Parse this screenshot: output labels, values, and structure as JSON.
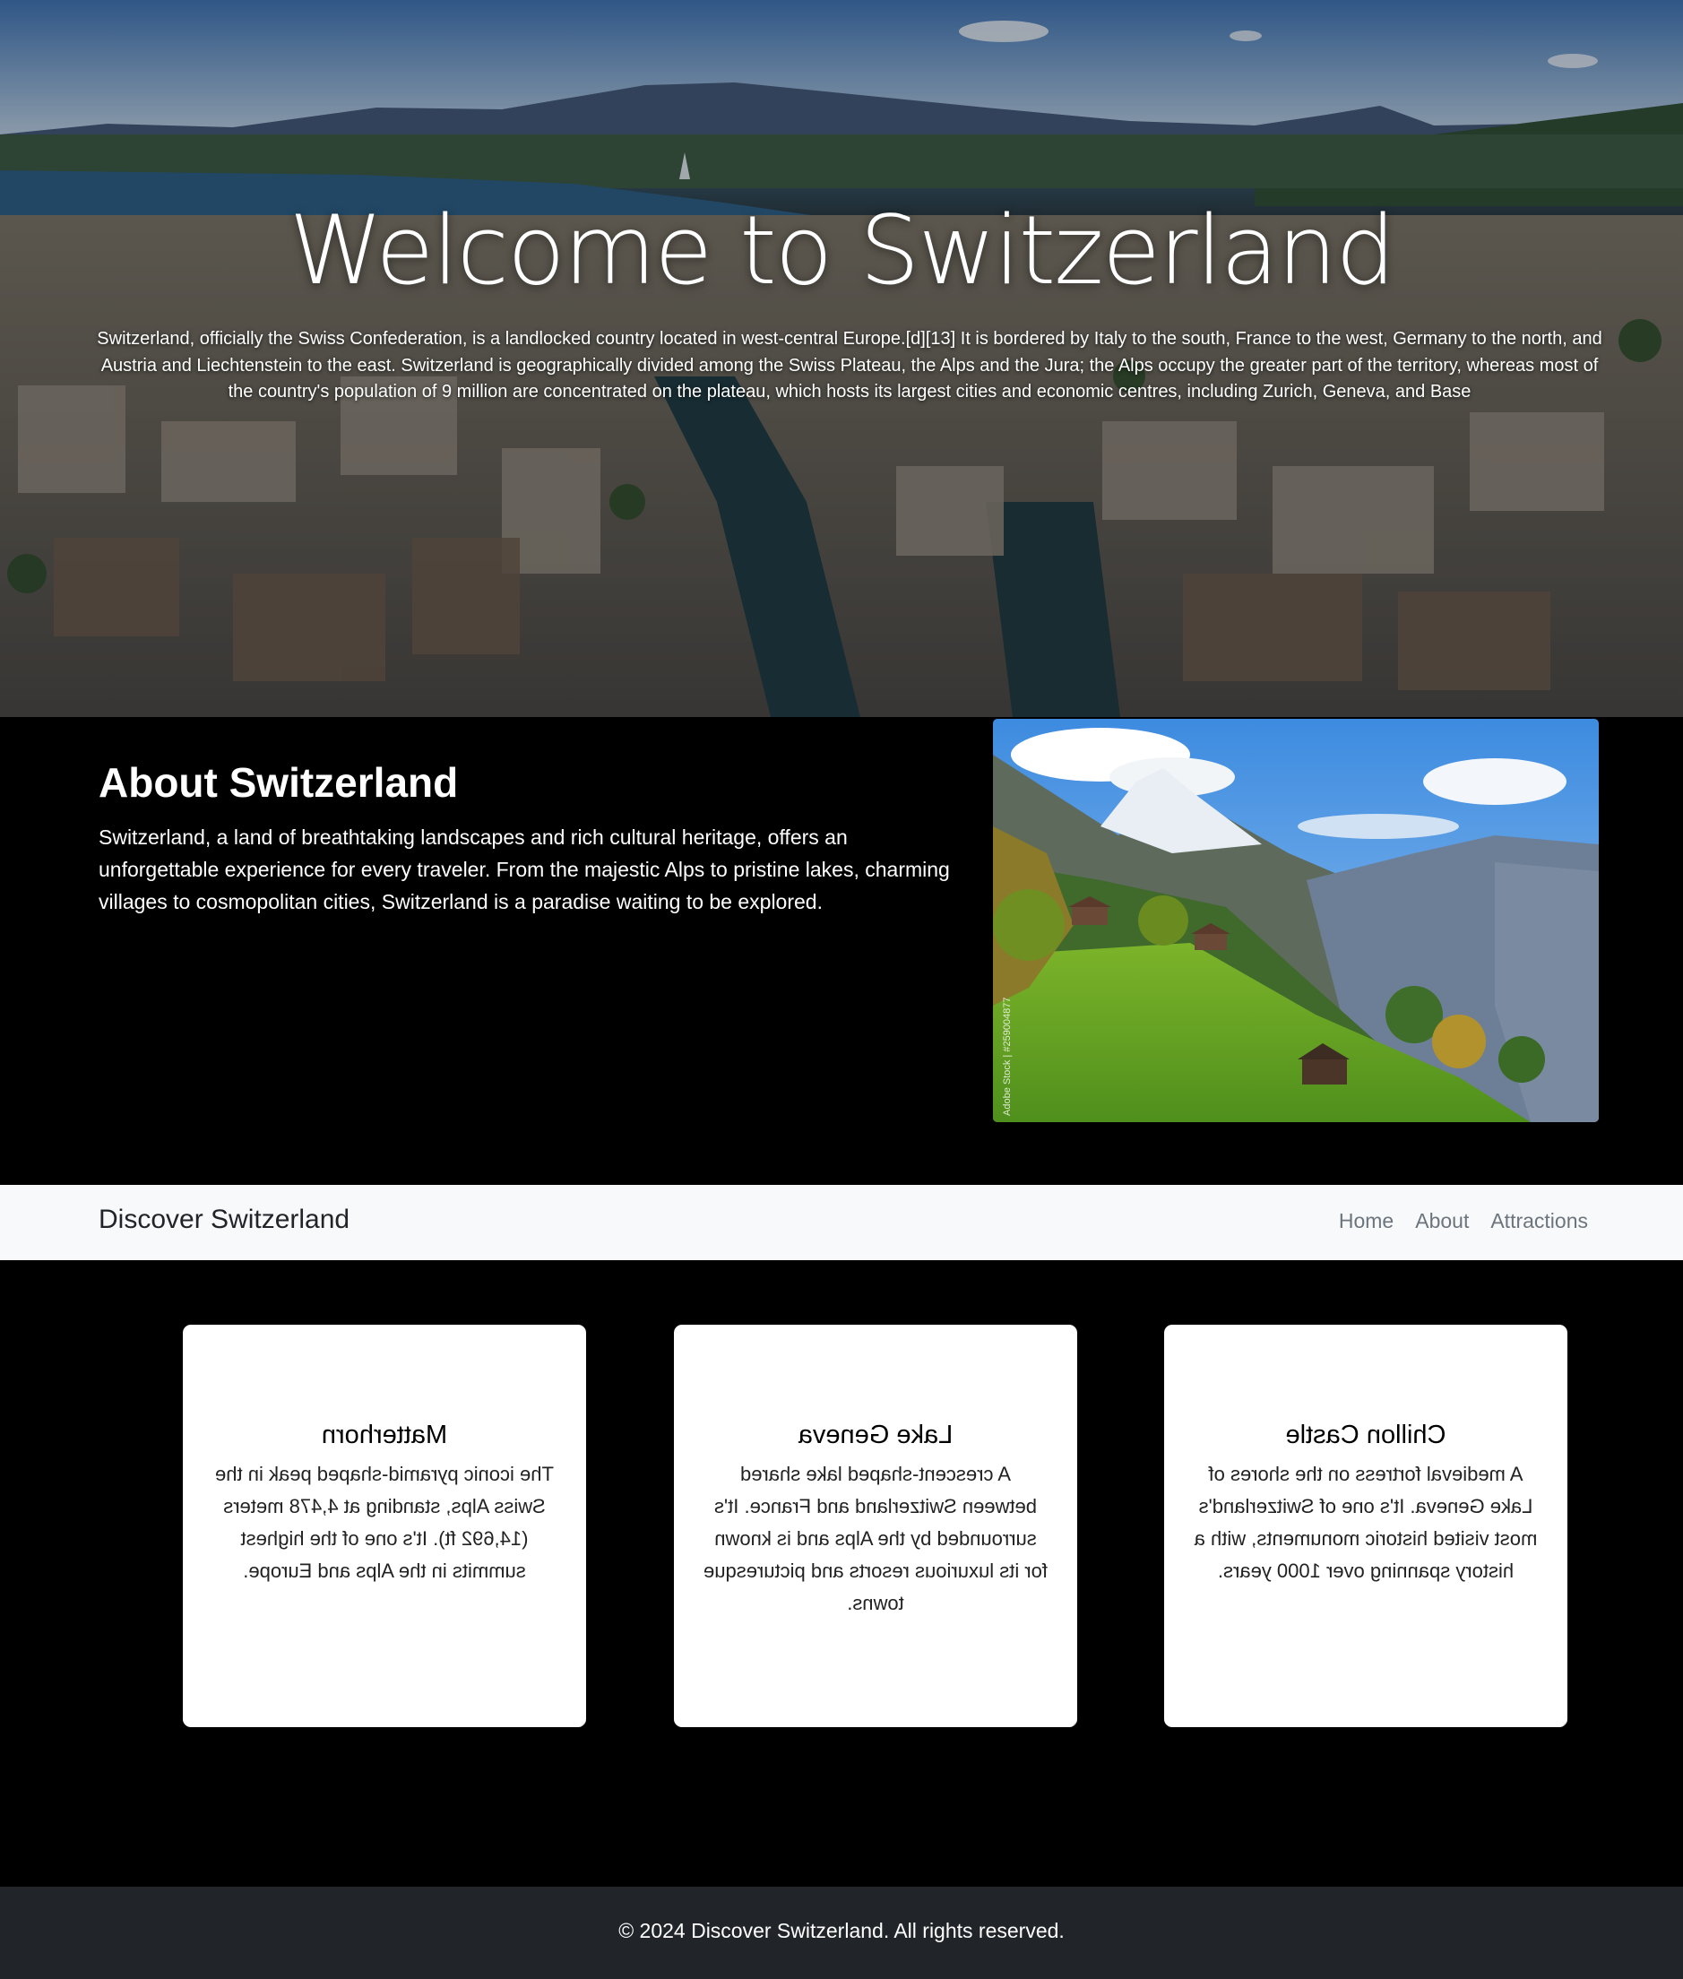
{
  "hero": {
    "title": "Welcome to Switzerland",
    "text": "Switzerland, officially the Swiss Confederation, is a landlocked country located in west-central Europe.[d][13] It is bordered by Italy to the south, France to the west, Germany to the north, and Austria and Liechtenstein to the east. Switzerland is geographically divided among the Swiss Plateau, the Alps and the Jura; the Alps occupy the greater part of the territory, whereas most of the country's population of 9 million are concentrated on the plateau, which hosts its largest cities and economic centres, including Zurich, Geneva, and Base"
  },
  "about": {
    "heading": "About Switzerland",
    "text": "Switzerland, a land of breathtaking landscapes and rich cultural heritage, offers an unforgettable experience for every traveler. From the majestic Alps to pristine lakes, charming villages to cosmopolitan cities, Switzerland is a paradise waiting to be explored.",
    "photo_credit": "Adobe Stock | #259004877"
  },
  "navbar": {
    "brand": "Discover Switzerland",
    "links": [
      "Home",
      "About",
      "Attractions"
    ]
  },
  "attractions": [
    {
      "title": "Matterhorn",
      "text": "The iconic pyramid-shaped peak in the Swiss Alps, standing at 4,478 meters (14,692 ft). It's one of the highest summits in the Alps and Europe."
    },
    {
      "title": "Lake Geneva",
      "text": "A crescent-shaped lake shared between Switzerland and France. It's surrounded by the Alps and is known for its luxurious resorts and picturesque towns."
    },
    {
      "title": "Chillon Castle",
      "text": "A medieval fortress on the shores of Lake Geneva. It's one of Switzerland's most visited historic monuments, with a history spanning over 1000 years."
    }
  ],
  "footer": {
    "text": "© 2024 Discover Switzerland. All rights reserved."
  },
  "colors": {
    "page_background": "#000000",
    "navbar_background": "#f8f9fa",
    "nav_link": "#6c757d",
    "brand_text": "#212529",
    "footer_background": "#212529",
    "card_background": "#ffffff"
  }
}
